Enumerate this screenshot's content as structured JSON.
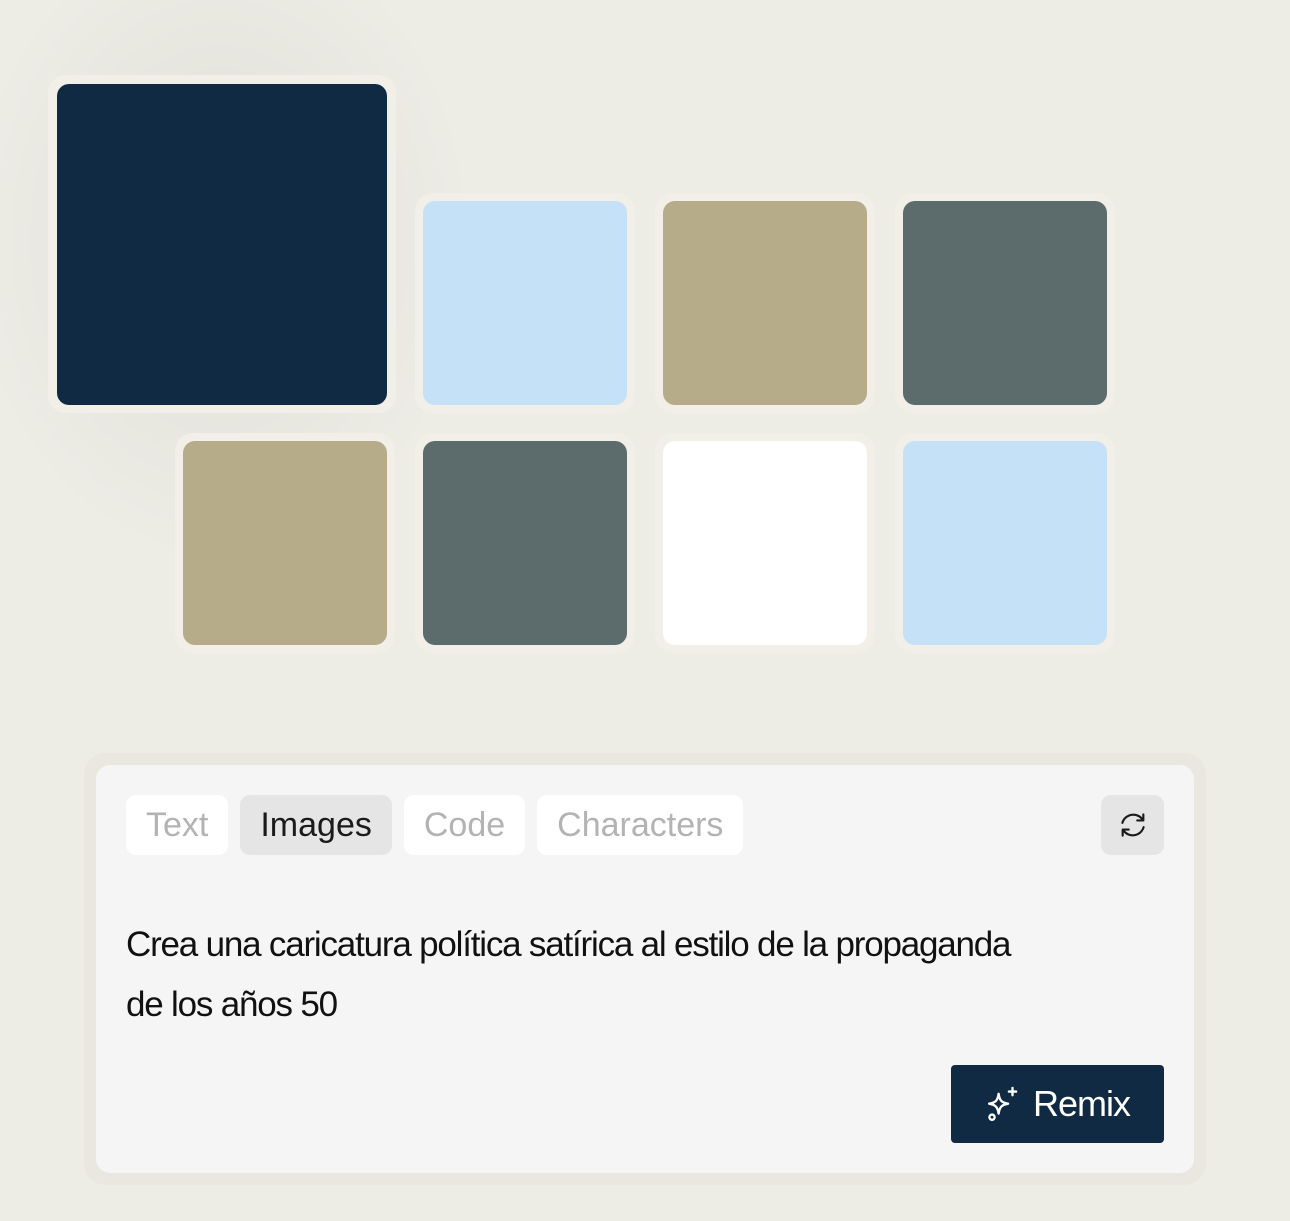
{
  "palette": {
    "main": {
      "color": "#112a43"
    },
    "swatches": [
      {
        "color": "#c5e1f8"
      },
      {
        "color": "#b7ac8a"
      },
      {
        "color": "#5c6b6b"
      },
      {
        "color": "#b7ac8a"
      },
      {
        "color": "#5c6b6b"
      },
      {
        "color": "#ffffff"
      },
      {
        "color": "#c5e1f8"
      }
    ]
  },
  "tabs": [
    {
      "label": "Text"
    },
    {
      "label": "Images",
      "active": true
    },
    {
      "label": "Code"
    },
    {
      "label": "Characters"
    }
  ],
  "refresh_icon": "refresh-icon",
  "prompt": {
    "line1": "Crea una caricatura política satírica al estilo de la propaganda",
    "line2": "de los años 50"
  },
  "remix": {
    "label": "Remix",
    "icon": "sparkles-icon"
  }
}
